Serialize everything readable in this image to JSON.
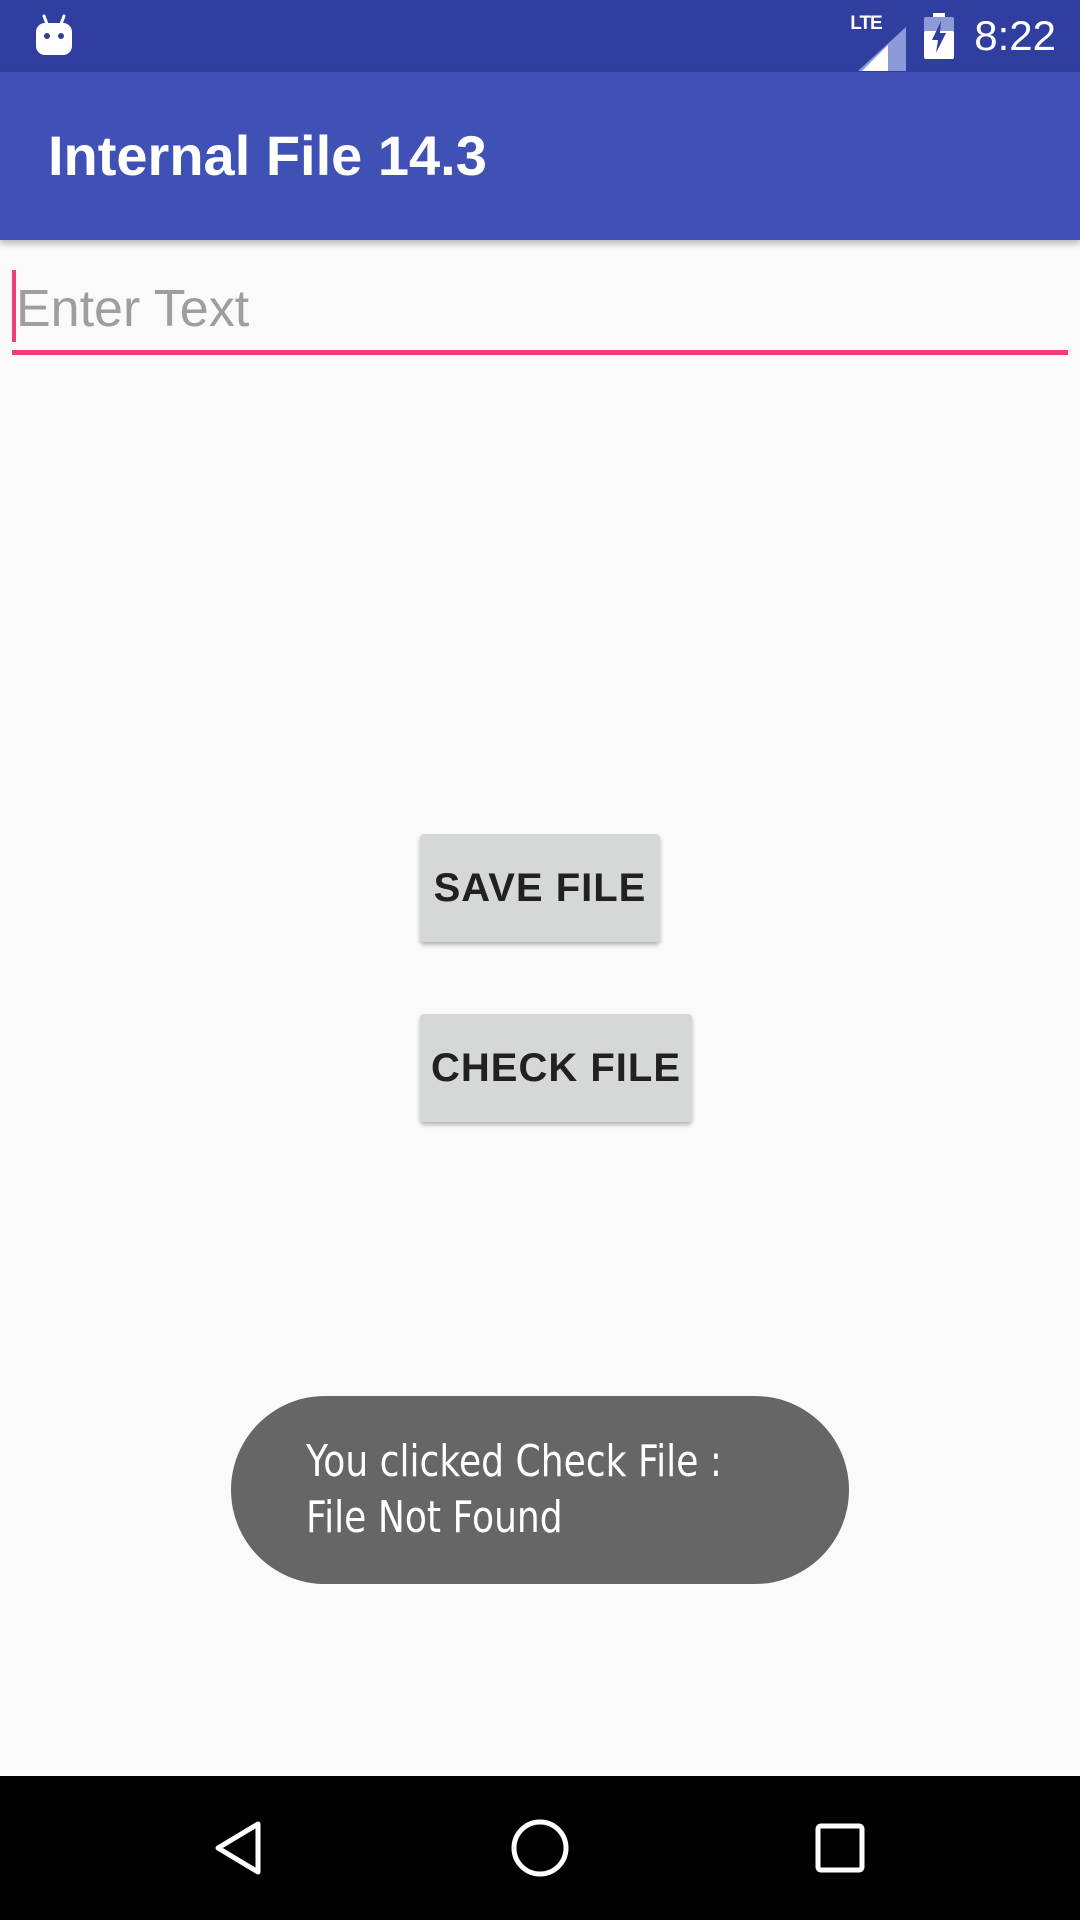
{
  "status_bar": {
    "network": "LTE",
    "time": "8:22",
    "left_icon": "android-debug-icon",
    "signal_icon": "cell-signal-icon",
    "battery_icon": "battery-charging-icon"
  },
  "app_bar": {
    "title": "Internal File 14.3"
  },
  "text_field": {
    "value": "",
    "placeholder": "Enter Text"
  },
  "buttons": {
    "save_label": "SAVE FILE",
    "check_label": "CHECK FILE"
  },
  "toast": {
    "line1": "You clicked Check File :",
    "line2": "File Not Found"
  },
  "nav_bar": {
    "back_icon": "back-icon",
    "home_icon": "home-icon",
    "recents_icon": "recents-icon"
  },
  "colors": {
    "status_bar": "#303f9f",
    "primary": "#3f51b5",
    "accent": "#ec407a",
    "background": "#fafafa",
    "button": "#d6d7d7",
    "toast": "#666666"
  }
}
